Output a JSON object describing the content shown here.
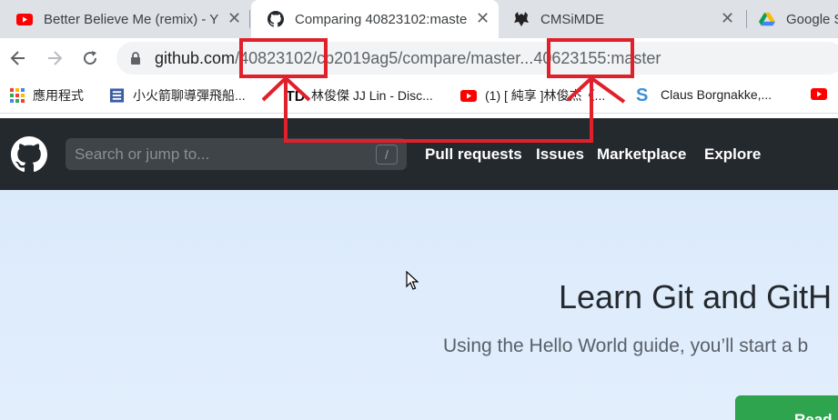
{
  "tabs": [
    {
      "title": "Better Believe Me (remix) - Y",
      "close": "✕",
      "favicon": "youtube-icon"
    },
    {
      "title": "Comparing 40823102:maste",
      "close": "✕",
      "favicon": "github-icon",
      "active": true
    },
    {
      "title": "CMSiMDE",
      "close": "✕",
      "favicon": "cmsimde-icon"
    },
    {
      "title": "Google S",
      "favicon": "google-drive-icon"
    }
  ],
  "address_bar": {
    "host": "github.com",
    "url_parts": [
      "/",
      "40823102",
      "/cp2019ag5/compare/master...",
      "40623155",
      ":master"
    ]
  },
  "bookmarks": [
    {
      "label": "應用程式",
      "icon": "apps-grid-icon"
    },
    {
      "label": "小火箭聊導彈飛船...",
      "icon": "page-icon"
    },
    {
      "label": "林俊傑 JJ Lin - Disc...",
      "icon": "jjlin-td-icon"
    },
    {
      "label": "(1) [ 純享 ]林俊杰《...",
      "icon": "youtube-icon"
    },
    {
      "label": "Claus Borgnakke,...",
      "icon": "s-logo-icon"
    },
    {
      "label": "",
      "icon": "youtube-icon"
    }
  ],
  "github": {
    "search_placeholder": "Search or jump to...",
    "slash_key": "/",
    "nav": [
      "Pull requests",
      "Issues",
      "Marketplace",
      "Explore"
    ]
  },
  "hero": {
    "title": "Learn Git and GitH",
    "subtitle": "Using the Hello World guide, you’ll start a b",
    "button": "Read"
  },
  "colors": {
    "annotation_red": "#e0202a",
    "github_header": "#24292e",
    "primary_green": "#2ea44f",
    "youtube_red": "#ff0000"
  }
}
